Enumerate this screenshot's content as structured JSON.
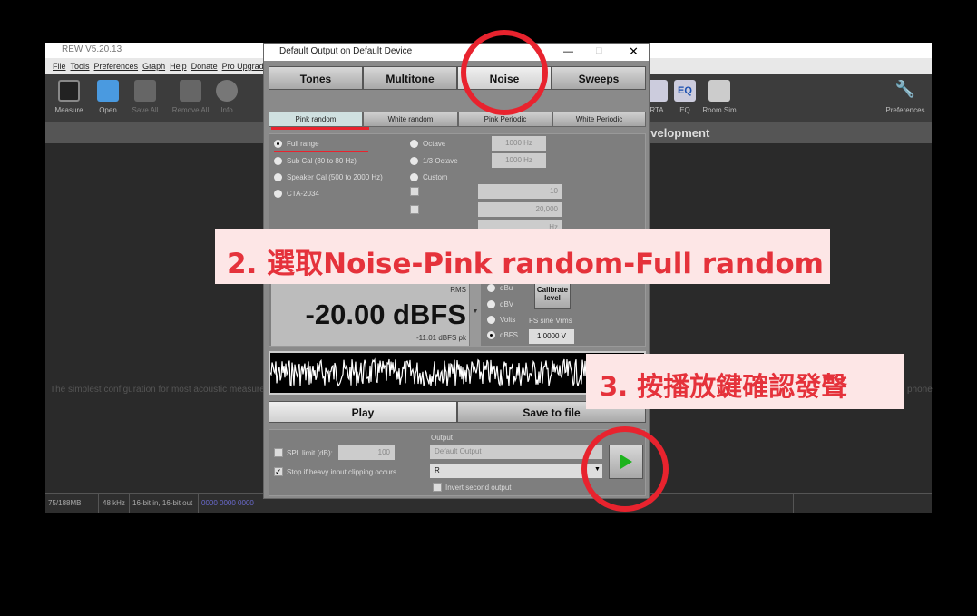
{
  "main": {
    "title": "REW V5.20.13",
    "menu": [
      "File",
      "Tools",
      "Preferences",
      "Graph",
      "Help",
      "Donate",
      "Pro Upgrades"
    ],
    "toolbar": [
      "Measure",
      "Open",
      "Save All",
      "Remove All",
      "Info",
      "RTA",
      "EQ",
      "Room Sim",
      "Preferences"
    ],
    "banner": "REW is free software, but please donate to support its continuing development",
    "hint": "The simplest configuration for most acoustic measure",
    "hint_right": "phone",
    "status": {
      "memory": "75/188MB",
      "rate": "48 kHz",
      "bits": "16-bit in, 16-bit out",
      "meter": "0000 0000  0000"
    }
  },
  "dialog": {
    "title": "Default Output on Default Device",
    "tabs": [
      "Tones",
      "Multitone",
      "Noise",
      "Sweeps"
    ],
    "active_tab": "Noise",
    "subtabs": [
      "Pink random",
      "White random",
      "Pink Periodic",
      "White Periodic"
    ],
    "active_subtab": "Pink random",
    "range_options": [
      "Full range",
      "Sub Cal (30 to 80 Hz)",
      "Speaker Cal (500 to 2000 Hz)",
      "CTA-2034"
    ],
    "selected_range": "Full range",
    "band_options": [
      "Octave",
      "1/3 Octave",
      "Custom"
    ],
    "octave_freq": "1000 Hz",
    "third_octave_freq": "1000 Hz",
    "custom_low": "10",
    "custom_high": "20,000",
    "custom_unit": "Hz",
    "level": {
      "rms_label": "RMS",
      "value": "-20.00 dBFS",
      "peak": "-11.01 dBFS pk",
      "units": [
        "dBu",
        "dBV",
        "Volts",
        "dBFS"
      ],
      "selected_unit": "dBFS",
      "calibrate": "Calibrate level",
      "fs_label": "FS sine Vrms",
      "fs_value": "1.0000 V"
    },
    "play": "Play",
    "save": "Save to file",
    "spl_limit_label": "SPL limit (dB):",
    "spl_limit": "100",
    "spl_checked": false,
    "stop_clip_label": "Stop if heavy input clipping occurs",
    "stop_clip_checked": true,
    "output_label": "Output",
    "output_device": "Default Output",
    "output_channel": "R",
    "invert_label": "Invert second output"
  },
  "annotations": {
    "step2": "2. 選取Noise-Pink random-Full random",
    "step3": "3. 按播放鍵確認發聲",
    "color": "#e5323b"
  }
}
